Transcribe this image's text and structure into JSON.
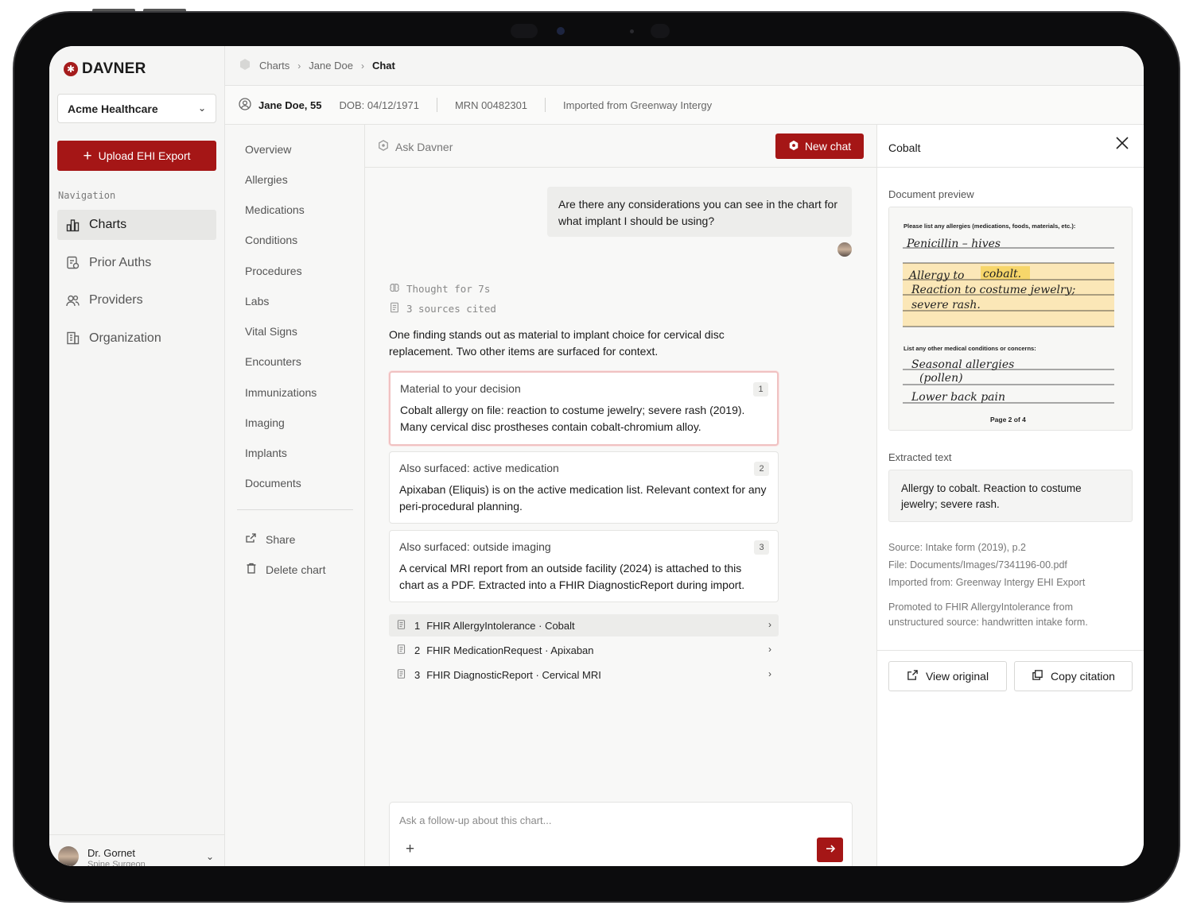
{
  "brand": {
    "name": "DAVNER",
    "accent": "#a51616"
  },
  "sidebar": {
    "org": "Acme Healthcare",
    "upload_label": "Upload EHI Export",
    "nav_heading": "Navigation",
    "items": [
      {
        "label": "Charts",
        "icon": "charts-icon",
        "active": true
      },
      {
        "label": "Prior Auths",
        "icon": "prior-auths-icon"
      },
      {
        "label": "Providers",
        "icon": "providers-icon"
      },
      {
        "label": "Organization",
        "icon": "organization-icon"
      }
    ],
    "user": {
      "name": "Dr. Gornet",
      "role": "Spine Surgeon"
    }
  },
  "breadcrumb": [
    "Charts",
    "Jane Doe",
    "Chat"
  ],
  "patient": {
    "name": "Jane Doe, 55",
    "dob": "DOB: 04/12/1971",
    "mrn": "MRN 00482301",
    "source": "Imported from Greenway Intergy"
  },
  "chart_nav": {
    "items": [
      "Overview",
      "Allergies",
      "Medications",
      "Conditions",
      "Procedures",
      "Labs",
      "Vital Signs",
      "Encounters",
      "Immunizations",
      "Imaging",
      "Implants",
      "Documents"
    ],
    "actions": [
      "Share",
      "Delete chart"
    ]
  },
  "chat": {
    "ask_label": "Ask Davner",
    "new_chat": "New chat",
    "user_message": "Are there any considerations you can see in the chart for what implant I should be using?",
    "thought": "Thought for 7s",
    "sources": "3 sources cited",
    "intro": "One finding stands out as material to implant choice for cervical disc replacement. Two other items are surfaced for context.",
    "cards": [
      {
        "title": "Material to your decision",
        "num": "1",
        "body": "Cobalt allergy on file: reaction to costume jewelry; severe rash (2019). Many cervical disc prostheses contain cobalt-chromium alloy."
      },
      {
        "title": "Also surfaced: active medication",
        "num": "2",
        "body": "Apixaban (Eliquis) is on the active medication list. Relevant context for any peri-procedural planning."
      },
      {
        "title": "Also surfaced: outside imaging",
        "num": "3",
        "body": "A cervical MRI report from an outside facility (2024) is attached to this chart as a PDF. Extracted into a FHIR DiagnosticReport during import."
      }
    ],
    "citations": [
      {
        "num": "1",
        "label": "FHIR AllergyIntolerance · Cobalt"
      },
      {
        "num": "2",
        "label": "FHIR MedicationRequest · Apixaban"
      },
      {
        "num": "3",
        "label": "FHIR DiagnosticReport · Cervical MRI"
      }
    ],
    "composer_placeholder": "Ask a follow-up about this chart..."
  },
  "panel": {
    "title": "Cobalt",
    "preview_label": "Document preview",
    "doc": {
      "prompt1": "Please list any allergies (medications, foods, materials, etc.):",
      "line1": "Penicillin – hives",
      "line2a": "Allergy to",
      "line2b": "cobalt.",
      "line3": "Reaction to costume jewelry;",
      "line4": "severe rash.",
      "prompt2": "List any other medical conditions or concerns:",
      "line5": "Seasonal allergies",
      "line6": "(pollen)",
      "line7": "Lower back pain",
      "page": "Page 2 of 4"
    },
    "extracted_label": "Extracted text",
    "extracted_text": "Allergy to cobalt. Reaction to costume jewelry; severe rash.",
    "source": "Source: Intake form (2019), p.2",
    "file": "File: Documents/Images/7341196-00.pdf",
    "imported": "Imported from: Greenway Intergy EHI Export",
    "promoted": "Promoted to FHIR AllergyIntolerance from unstructured source: handwritten intake form.",
    "view_original": "View original",
    "copy_citation": "Copy citation"
  }
}
